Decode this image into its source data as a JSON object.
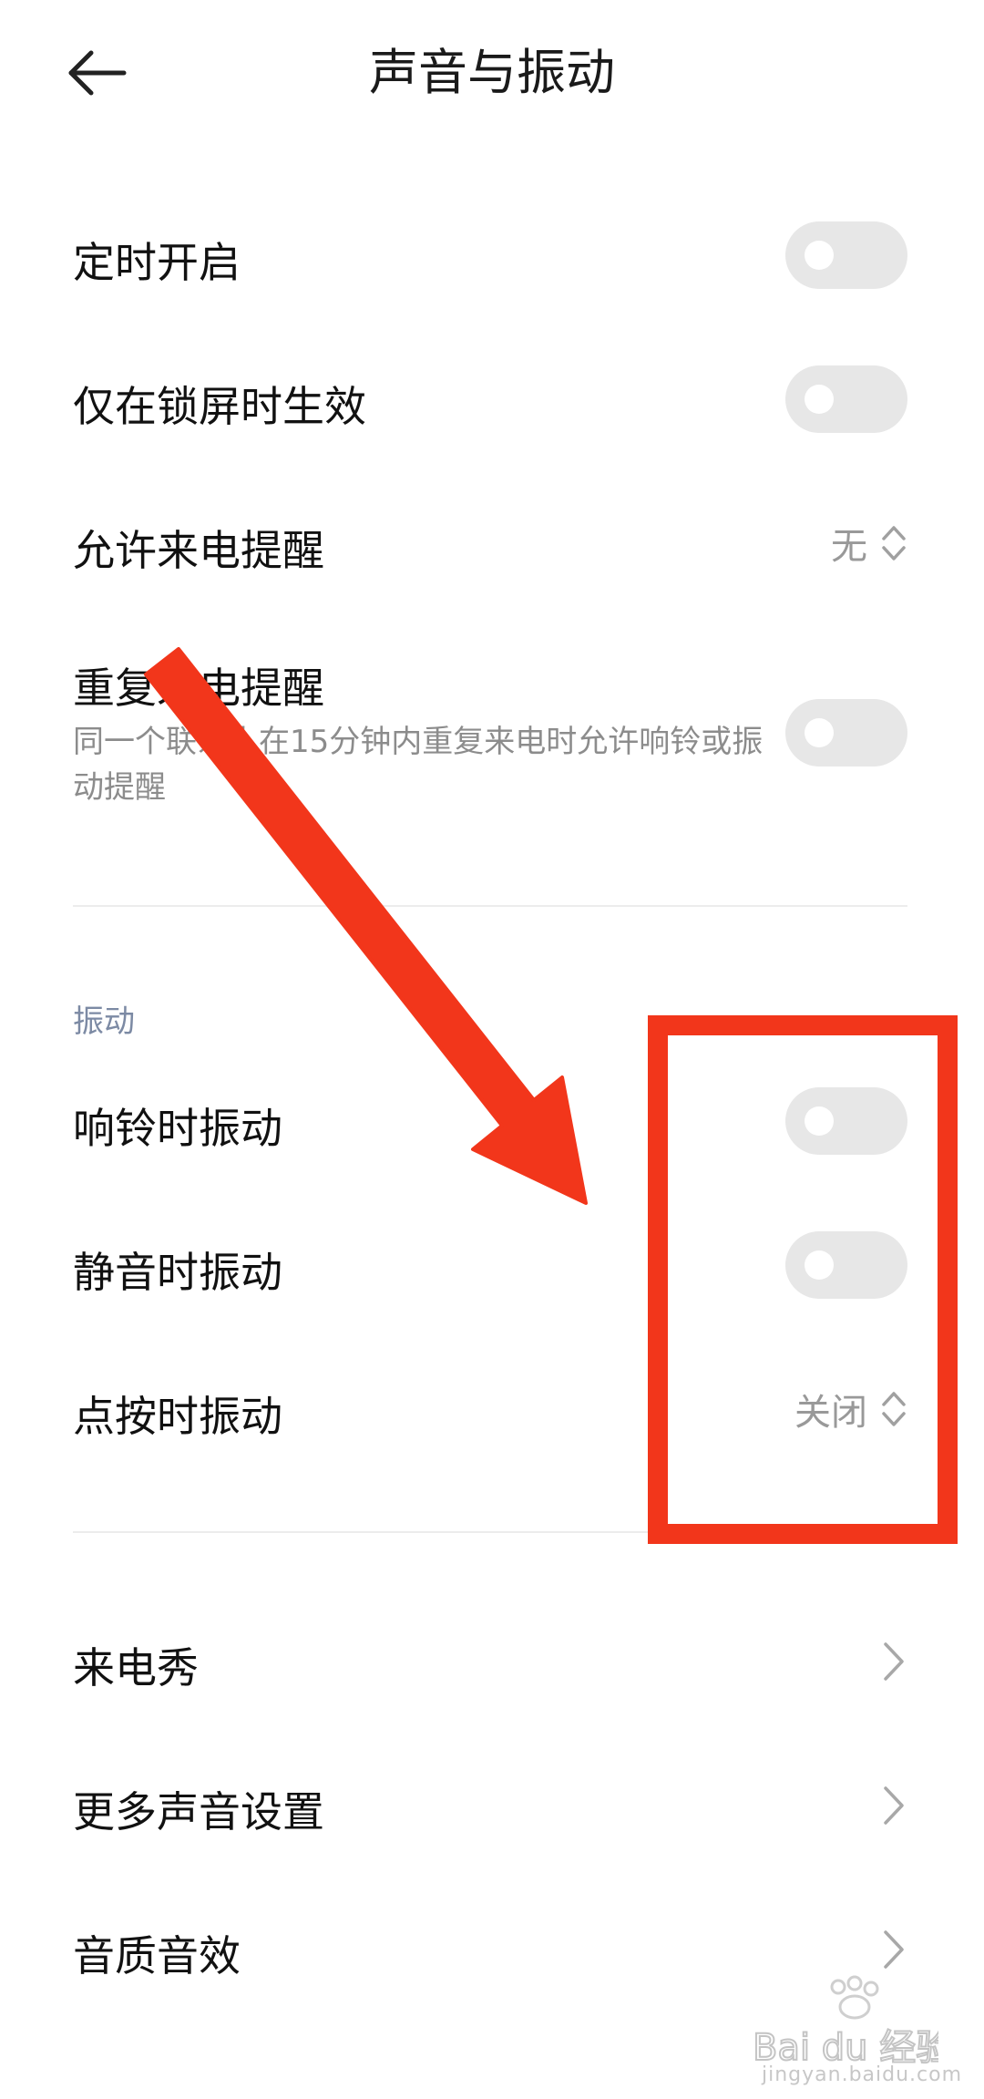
{
  "header": {
    "title": "声音与振动",
    "back_icon": "arrow-left-icon"
  },
  "rows": {
    "scheduled_on": {
      "label": "定时开启",
      "toggle_on": false
    },
    "lock_screen_only": {
      "label": "仅在锁屏时生效",
      "toggle_on": false
    },
    "allow_calls": {
      "label": "允许来电提醒",
      "value": "无"
    },
    "repeat_calls": {
      "label": "重复来电提醒",
      "desc": "同一个联系人在15分钟内重复来电时允许响铃或振动提醒",
      "toggle_on": false
    }
  },
  "vibration": {
    "section_title": "振动",
    "ring_vibrate": {
      "label": "响铃时振动",
      "toggle_on": false
    },
    "silent_vibrate": {
      "label": "静音时振动",
      "toggle_on": false
    },
    "tap_vibrate": {
      "label": "点按时振动",
      "value": "关闭"
    }
  },
  "more": {
    "incoming_show": {
      "label": "来电秀"
    },
    "more_sound": {
      "label": "更多声音设置"
    },
    "audio_quality": {
      "label": "音质音效"
    }
  },
  "annotation": {
    "color": "#f2361b"
  },
  "watermark": {
    "logo_text": "Bai du 经验",
    "url": "jingyan.baidu.com"
  }
}
